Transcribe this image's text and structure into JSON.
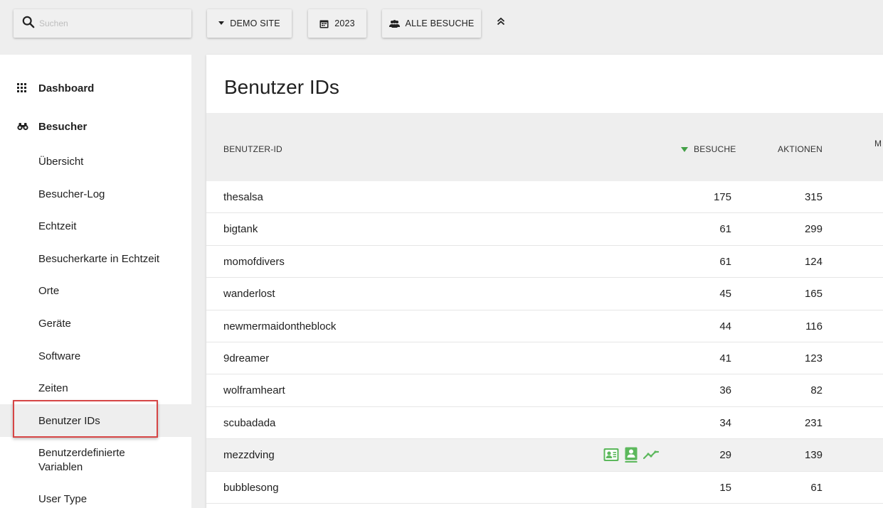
{
  "search": {
    "placeholder": "Suchen",
    "value": ""
  },
  "toolbar": {
    "site_label": "DEMO SITE",
    "date_label": "2023",
    "segment_label": "ALLE BESUCHE"
  },
  "sidebar": {
    "dashboard_label": "Dashboard",
    "visitors_label": "Besucher",
    "items": [
      {
        "label": "Übersicht"
      },
      {
        "label": "Besucher-Log"
      },
      {
        "label": "Echtzeit"
      },
      {
        "label": "Besucherkarte in Echtzeit"
      },
      {
        "label": "Orte"
      },
      {
        "label": "Geräte"
      },
      {
        "label": "Software"
      },
      {
        "label": "Zeiten"
      },
      {
        "label": "Benutzer IDs"
      },
      {
        "label": "Benutzerdefinierte Variablen"
      },
      {
        "label": "User Type"
      }
    ],
    "active_index": 8
  },
  "main": {
    "title": "Benutzer IDs",
    "columns": {
      "user_id": "BENUTZER-ID",
      "visits": "BESUCHE",
      "actions": "AKTIONEN",
      "more": "M"
    },
    "rows": [
      {
        "user_id": "thesalsa",
        "visits": "175",
        "actions": "315"
      },
      {
        "user_id": "bigtank",
        "visits": "61",
        "actions": "299"
      },
      {
        "user_id": "momofdivers",
        "visits": "61",
        "actions": "124"
      },
      {
        "user_id": "wanderlost",
        "visits": "45",
        "actions": "165"
      },
      {
        "user_id": "newmermaidontheblock",
        "visits": "44",
        "actions": "116"
      },
      {
        "user_id": "9dreamer",
        "visits": "41",
        "actions": "123"
      },
      {
        "user_id": "wolframheart",
        "visits": "36",
        "actions": "82"
      },
      {
        "user_id": "scubadada",
        "visits": "34",
        "actions": "231"
      },
      {
        "user_id": "mezzdving",
        "visits": "29",
        "actions": "139"
      },
      {
        "user_id": "bubblesong",
        "visits": "15",
        "actions": "61"
      }
    ],
    "hovered_row_index": 8
  },
  "colors": {
    "accent": "#43a047",
    "row_icon": "#5cb85c",
    "highlight_box": "#d64545"
  },
  "icons": {
    "search": "search-icon",
    "site": "caret-down-icon",
    "date": "calendar-icon",
    "segment": "users-icon",
    "collapse": "double-chevron-up-icon",
    "dashboard": "grid-icon",
    "visitors": "binoculars-icon",
    "row_actions": [
      "visitor-profile-icon",
      "segmented-visitor-log-icon",
      "row-evolution-icon"
    ]
  }
}
